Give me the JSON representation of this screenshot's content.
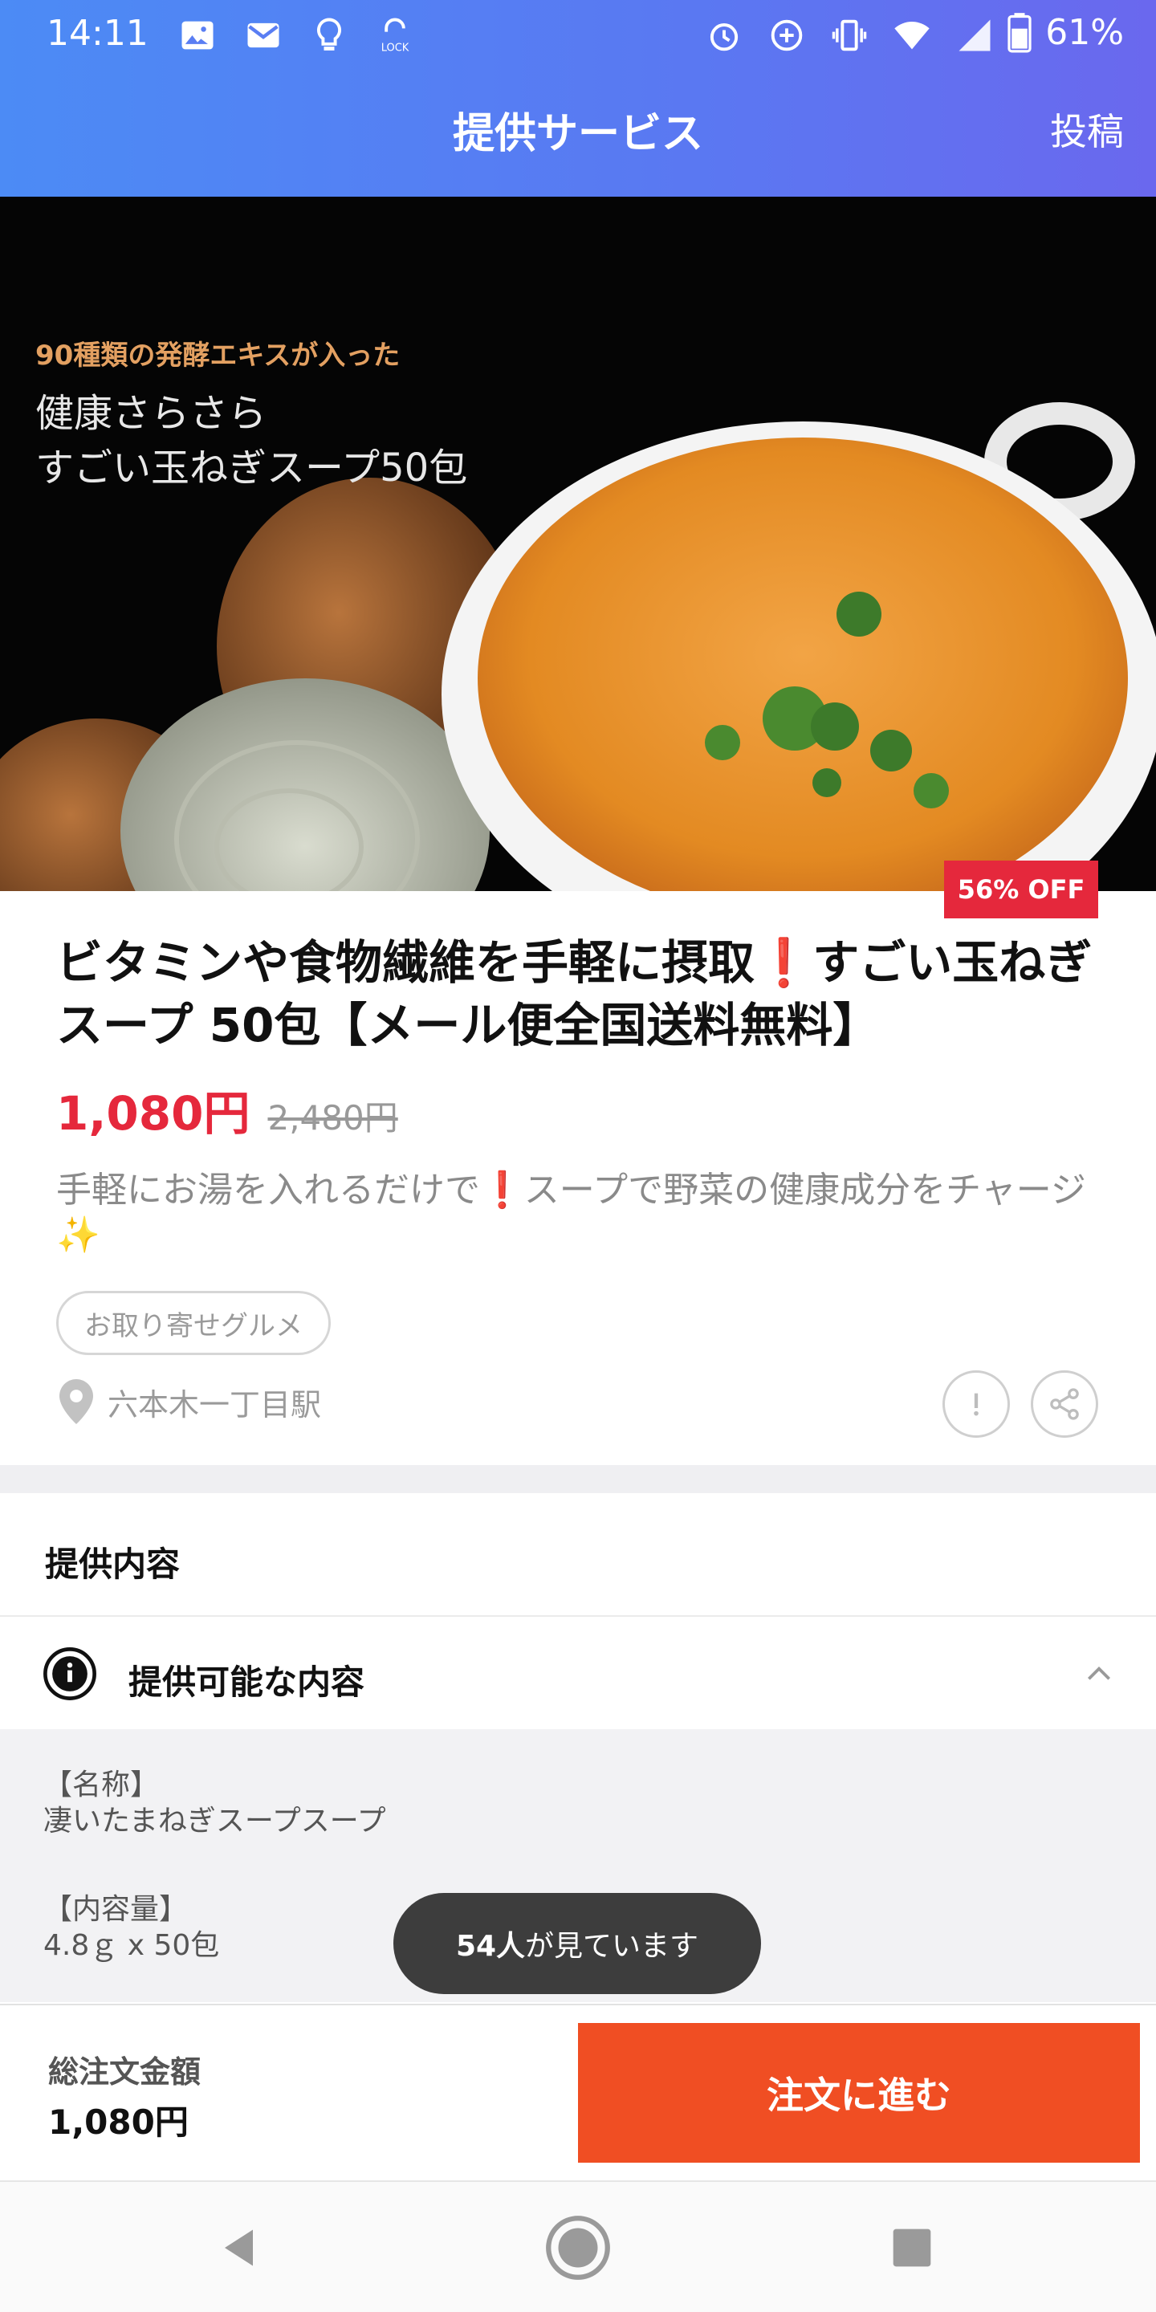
{
  "status_bar": {
    "time": "14:11",
    "battery": "61%",
    "left_icons": [
      "image-icon",
      "mail-icon",
      "bulb-icon",
      "lock-icon"
    ],
    "right_icons": [
      "alarm-icon",
      "data-saver-icon",
      "vibrate-icon",
      "wifi-icon",
      "signal-icon",
      "battery-icon"
    ]
  },
  "app_bar": {
    "title": "提供サービス",
    "post_label": "投稿"
  },
  "hero": {
    "tag": "90種類の発酵エキスが入った",
    "line1": "健康さらさら",
    "line2": "すごい玉ねぎスープ50包"
  },
  "product": {
    "discount": "56% OFF",
    "title": "ビタミンや食物繊維を手軽に摂取❗すごい玉ねぎスープ 50包【メール便全国送料無料】",
    "price": "1,080円",
    "original_price": "2,480円",
    "description": "手軽にお湯を入れるだけで❗スープで野菜の健康成分をチャージ✨",
    "category": "お取り寄せグルメ",
    "location": "六本木一丁目駅"
  },
  "details": {
    "section_title": "提供内容",
    "accordion_label": "提供可能な内容",
    "specs": [
      {
        "label": "【名称】",
        "value": "凄いたまねぎスープスープ"
      },
      {
        "label": "【内容量】",
        "value": "4.8ｇ x 50包"
      }
    ]
  },
  "toast": {
    "count": "54人",
    "suffix": "が見ています"
  },
  "order_bar": {
    "total_label": "総注文金額",
    "total_value": "1,080円",
    "order_button": "注文に進む"
  },
  "colors": {
    "header_gradient_start": "#4c8bf5",
    "header_gradient_end": "#6a68ee",
    "price_red": "#e5283c",
    "order_orange": "#f04e23"
  }
}
